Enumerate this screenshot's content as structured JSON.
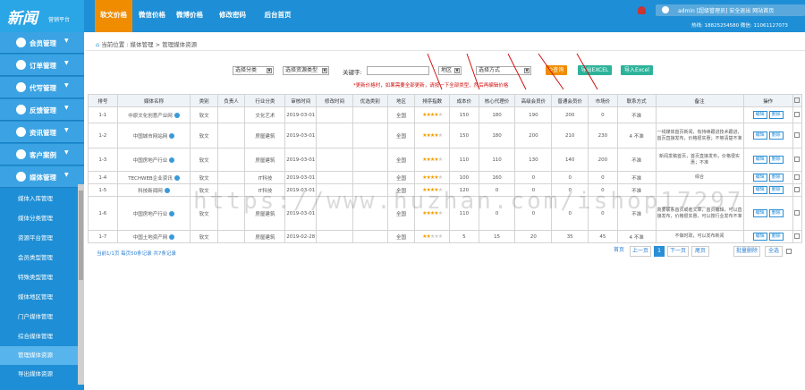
{
  "app": {
    "logo": "新闻",
    "logo_sub": "营销平台"
  },
  "topnav": [
    "软文价格",
    "微信价格",
    "微博价格",
    "修改密码",
    "后台首页"
  ],
  "user": {
    "admin_text": "admin [超级管理员]   安全退出   网站首页",
    "phone_text": "热线: 18825254580   微信: 11061127073"
  },
  "sidebar": {
    "groups": [
      "会员管理",
      "订单管理",
      "代写管理",
      "反馈管理",
      "资讯管理",
      "客户案例",
      "媒体管理"
    ],
    "subitems": [
      "媒体入库管理",
      "媒体分类管理",
      "资源平台管理",
      "会员类型管理",
      "特殊类型管理",
      "媒体地区管理",
      "门户媒体管理",
      "综合媒体管理",
      "管理媒体资源",
      "导出媒体资源"
    ]
  },
  "breadcrumb": "当前位置 : 媒体管理 > 管理媒体资源",
  "filters": {
    "cat": "选择分类",
    "res": "选择资源类型",
    "kw_label": "关键字:",
    "region": "地区",
    "sort": "选择方式",
    "search_btn": "查询",
    "export_excel": "导出EXCEL",
    "import_excel": "导入Excel",
    "notice": "*更新价格时，如果需要全部更新，请按一下全部类型，然后再编辑价格"
  },
  "columns": [
    "排号",
    "媒体名称",
    "类别",
    "负责人",
    "行业分类",
    "审核时间",
    "修改时间",
    "优选类别",
    "地区",
    "排序指数",
    "成本价",
    "核心代理价",
    "高级会员价",
    "普通会员价",
    "市场价",
    "联系方式",
    "备注",
    "操作"
  ],
  "rows": [
    {
      "id": "1-1",
      "name": "中原文化创意产业网",
      "type": "软文",
      "owner": "",
      "industry": "文化艺术",
      "date": "2019-03-01",
      "mdate": "",
      "pref": "",
      "region": "全国",
      "stars": 4,
      "c": "150",
      "p1": "180",
      "p2": "190",
      "p3": "200",
      "mkt": "0",
      "contact": "不准",
      "note": ""
    },
    {
      "id": "1-2",
      "name": "中国城市网站网",
      "type": "软文",
      "owner": "",
      "industry": "房屋建筑",
      "date": "2019-03-01",
      "mdate": "",
      "pref": "",
      "region": "全国",
      "stars": 4,
      "c": "150",
      "p1": "180",
      "p2": "200",
      "p3": "210",
      "mkt": "230",
      "contact": "4 不准",
      "note": "一线媒体首页新闻，有持续跟进技术跟进，首页直接发布，价格很实惠；不够清楚不准"
    },
    {
      "id": "1-3",
      "name": "中国房地产行业",
      "type": "软文",
      "owner": "",
      "industry": "房屋建筑",
      "date": "2019-03-01",
      "mdate": "",
      "pref": "",
      "region": "全国",
      "stars": 4,
      "c": "110",
      "p1": "110",
      "p2": "130",
      "p3": "140",
      "mkt": "200",
      "contact": "不准",
      "note": "新闻发稿首页，首页直接发布，价格很实惠；不准"
    },
    {
      "id": "1-4",
      "name": "TECHWEB企业资讯",
      "type": "软文",
      "owner": "",
      "industry": "IT科技",
      "date": "2019-03-01",
      "mdate": "",
      "pref": "",
      "region": "全国",
      "stars": 4,
      "c": "100",
      "p1": "160",
      "p2": "0",
      "p3": "0",
      "mkt": "0",
      "contact": "不准",
      "note": "综合"
    },
    {
      "id": "1-5",
      "name": "科技新闻网",
      "type": "软文",
      "owner": "",
      "industry": "IT科技",
      "date": "2019-03-01",
      "mdate": "",
      "pref": "",
      "region": "全国",
      "stars": 4,
      "c": "120",
      "p1": "0",
      "p2": "0",
      "p3": "0",
      "mkt": "0",
      "contact": "不准",
      "note": ""
    },
    {
      "id": "1-6",
      "name": "中国房地产行业",
      "type": "软文",
      "owner": "",
      "industry": "房屋建筑",
      "date": "2019-03-01",
      "mdate": "",
      "pref": "",
      "region": "全国",
      "stars": 4,
      "c": "110",
      "p1": "0",
      "p2": "0",
      "p3": "0",
      "mkt": "0",
      "contact": "不准",
      "note": "真要联系首页或者文章，首页编辑，可以直接发布，价格很实惠，可以按行业发布不准"
    },
    {
      "id": "1-7",
      "name": "中国土地资产网",
      "type": "软文",
      "owner": "",
      "industry": "房屋建筑",
      "date": "2019-02-28",
      "mdate": "",
      "pref": "",
      "region": "全国",
      "stars": 2,
      "c": "5",
      "p1": "15",
      "p2": "20",
      "p3": "35",
      "mkt": "45",
      "contact": "4 不准",
      "note": "不做时政，可以发布新闻"
    }
  ],
  "row_buttons": {
    "edit": "编辑",
    "delete": "删除"
  },
  "pagination": {
    "info": "当前1/1页 每页50条记录 共7条记录",
    "first": "首页",
    "prev": "上一页",
    "current": "1",
    "next": "下一页",
    "last": "尾页",
    "btn_a": "批量删除",
    "btn_b": "全选"
  },
  "watermark": "https://www.huzhan.com/ishop17297",
  "colors": {
    "topbar": "#1e8fd6",
    "accent": "#f08c00",
    "sidebar": "#1e8fd6",
    "green": "#2db39a"
  }
}
